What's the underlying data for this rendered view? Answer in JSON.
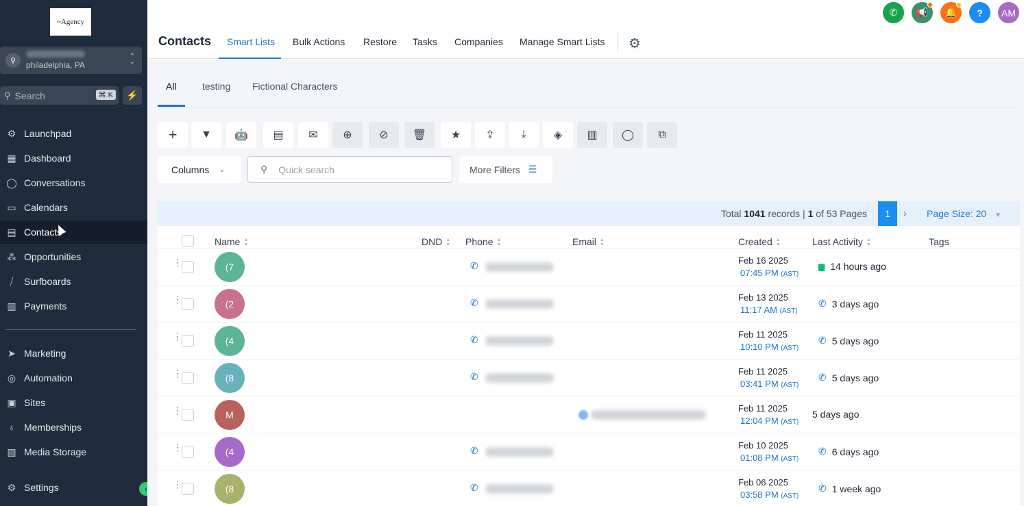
{
  "sidebar": {
    "logo_text": "Agency",
    "logo_sup": "the",
    "location_city": "philadelphia, PA",
    "search_placeholder": "Search",
    "search_shortcut": "⌘ K",
    "items": [
      {
        "label": "Launchpad",
        "icon": "rocket-icon",
        "glyph": "⚙"
      },
      {
        "label": "Dashboard",
        "icon": "dashboard-icon",
        "glyph": "▦"
      },
      {
        "label": "Conversations",
        "icon": "chat-bubble-icon",
        "glyph": "◯"
      },
      {
        "label": "Calendars",
        "icon": "calendar-icon",
        "glyph": "▭"
      },
      {
        "label": "Contacts",
        "icon": "contacts-icon",
        "glyph": "▤"
      },
      {
        "label": "Opportunities",
        "icon": "opportunities-icon",
        "glyph": "⁂"
      },
      {
        "label": "Surfboards",
        "icon": "surfboard-icon",
        "glyph": "⧸"
      },
      {
        "label": "Payments",
        "icon": "payments-icon",
        "glyph": "▥"
      }
    ],
    "items2": [
      {
        "label": "Marketing",
        "icon": "send-icon",
        "glyph": "➤"
      },
      {
        "label": "Automation",
        "icon": "automation-icon",
        "glyph": "◎"
      },
      {
        "label": "Sites",
        "icon": "sites-icon",
        "glyph": "▣"
      },
      {
        "label": "Memberships",
        "icon": "memberships-icon",
        "glyph": "♁"
      },
      {
        "label": "Media Storage",
        "icon": "media-icon",
        "glyph": "▨"
      }
    ],
    "settings_label": "Settings"
  },
  "header": {
    "title": "Contacts",
    "tabs": [
      "Smart Lists",
      "Bulk Actions",
      "Restore",
      "Tasks",
      "Companies",
      "Manage Smart Lists"
    ],
    "avatar_initials": "AM"
  },
  "colors": {
    "accent": "#1b76d3",
    "phone_btn": "#16a34a",
    "announce_btn": "#3f8f6b",
    "bell_btn": "#f97316",
    "help_btn": "#1b8cf0",
    "avatar_btn": "#a56bc7"
  },
  "sub_tabs": [
    "All",
    "testing",
    "Fictional Characters"
  ],
  "toolbar": {
    "columns_label": "Columns",
    "quick_search_placeholder": "Quick search",
    "more_filters_label": "More Filters"
  },
  "pager": {
    "total_prefix": "Total",
    "total_records": "1041",
    "records_word": "records |",
    "current_page": "1",
    "of_pages": "of 53 Pages",
    "page_size_label": "Page Size: 20"
  },
  "table": {
    "headers": {
      "name": "Name",
      "dnd": "DND",
      "phone": "Phone",
      "email": "Email",
      "created": "Created",
      "last_activity": "Last Activity",
      "tags": "Tags"
    },
    "rows": [
      {
        "initials": "(7",
        "color": "#5bb596",
        "has_phone": true,
        "has_email": false,
        "date": "Feb 16 2025",
        "time": "07:45 PM",
        "tz": "(AST)",
        "activity": "14 hours ago",
        "activity_icon": "sms"
      },
      {
        "initials": "(2",
        "color": "#c8708f",
        "has_phone": true,
        "has_email": false,
        "date": "Feb 13 2025",
        "time": "11:17 AM",
        "tz": "(AST)",
        "activity": "3 days ago",
        "activity_icon": "phone"
      },
      {
        "initials": "(4",
        "color": "#5bb596",
        "has_phone": true,
        "has_email": false,
        "date": "Feb 11 2025",
        "time": "10:10 PM",
        "tz": "(AST)",
        "activity": "5 days ago",
        "activity_icon": "phone"
      },
      {
        "initials": "(8",
        "color": "#69b1bf",
        "has_phone": true,
        "has_email": false,
        "date": "Feb 11 2025",
        "time": "03:41 PM",
        "tz": "(AST)",
        "activity": "5 days ago",
        "activity_icon": "phone"
      },
      {
        "initials": "M",
        "color": "#b8625f",
        "has_phone": false,
        "has_email": true,
        "date": "Feb 11 2025",
        "time": "12:04 PM",
        "tz": "(AST)",
        "activity": "5 days ago",
        "activity_icon": "none"
      },
      {
        "initials": "(4",
        "color": "#a56bc7",
        "has_phone": true,
        "has_email": false,
        "date": "Feb 10 2025",
        "time": "01:08 PM",
        "tz": "(AST)",
        "activity": "6 days ago",
        "activity_icon": "phone"
      },
      {
        "initials": "(8",
        "color": "#a9b26a",
        "has_phone": true,
        "has_email": false,
        "date": "Feb 06 2025",
        "time": "03:58 PM",
        "tz": "(AST)",
        "activity": "1 week ago",
        "activity_icon": "phone"
      }
    ]
  }
}
